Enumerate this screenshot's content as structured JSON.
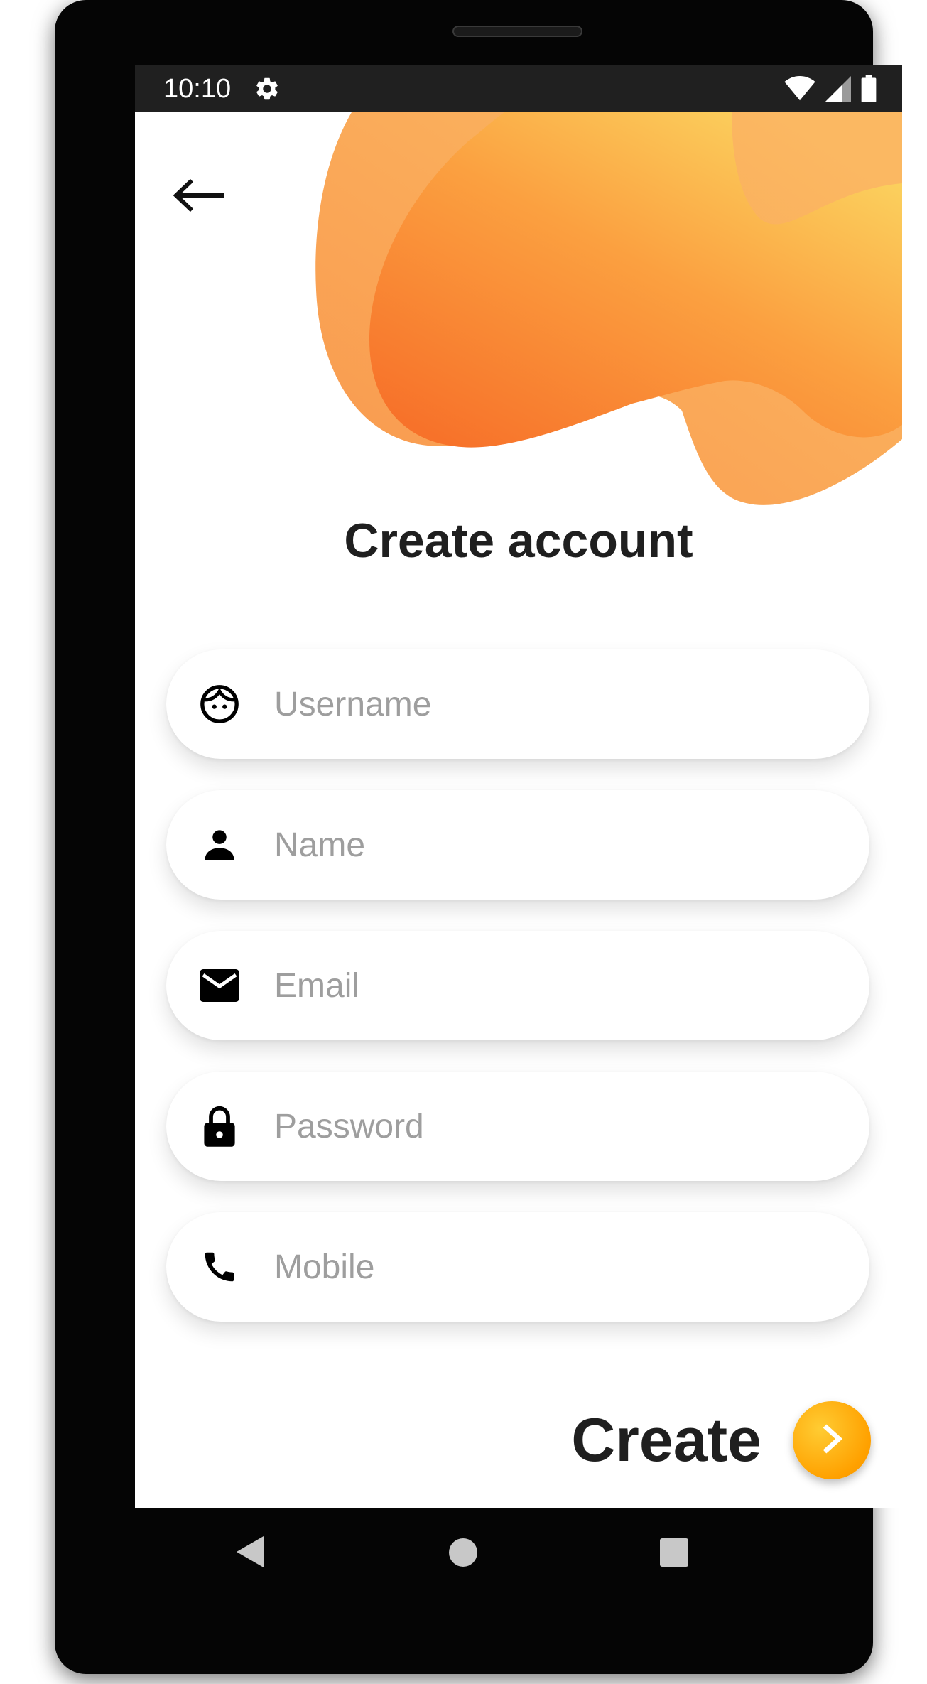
{
  "status_bar": {
    "time": "10:10",
    "icons": [
      "settings-gear-icon",
      "wifi-icon",
      "signal-icon",
      "battery-icon"
    ]
  },
  "header": {
    "back_icon": "arrow-left-icon",
    "title": "Create account"
  },
  "form": {
    "fields": [
      {
        "name": "username",
        "icon": "face-icon",
        "placeholder": "Username",
        "value": ""
      },
      {
        "name": "name",
        "icon": "person-icon",
        "placeholder": "Name",
        "value": ""
      },
      {
        "name": "email",
        "icon": "mail-icon",
        "placeholder": "Email",
        "value": ""
      },
      {
        "name": "password",
        "icon": "lock-icon",
        "placeholder": "Password",
        "value": ""
      },
      {
        "name": "mobile",
        "icon": "phone-icon",
        "placeholder": "Mobile",
        "value": ""
      }
    ]
  },
  "action": {
    "create_label": "Create",
    "button_icon": "chevron-right-icon"
  },
  "nav_bar": {
    "items": [
      "back-triangle-icon",
      "home-circle-icon",
      "recents-square-icon"
    ]
  },
  "colors": {
    "accent": "#ffa100",
    "blob_light": "#f9c55a",
    "blob_dark": "#f7742b",
    "status_bar": "#202020",
    "text_primary": "#1f1f1f",
    "placeholder": "#9e9e9e"
  }
}
